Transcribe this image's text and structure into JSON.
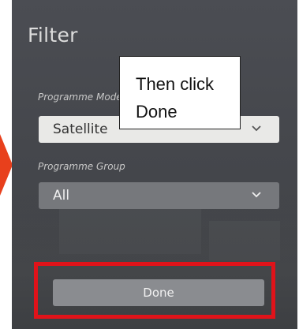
{
  "panel": {
    "title": "Filter"
  },
  "programme_mode": {
    "label": "Programme Mode",
    "value": "Satellite"
  },
  "programme_group": {
    "label": "Programme Group",
    "value": "All"
  },
  "done_button": {
    "label": "Done"
  },
  "tooltip": {
    "line1": "Then click",
    "line2": "Done"
  },
  "colors": {
    "panel_bg": "#45474c",
    "highlight_red": "#e0131a",
    "arrow_orange": "#e8401c",
    "button_bg": "#8a8c90"
  },
  "icons": {
    "dropdown_chevron": "chevron-down-icon",
    "pointer_arrow": "arrow-right-icon"
  }
}
